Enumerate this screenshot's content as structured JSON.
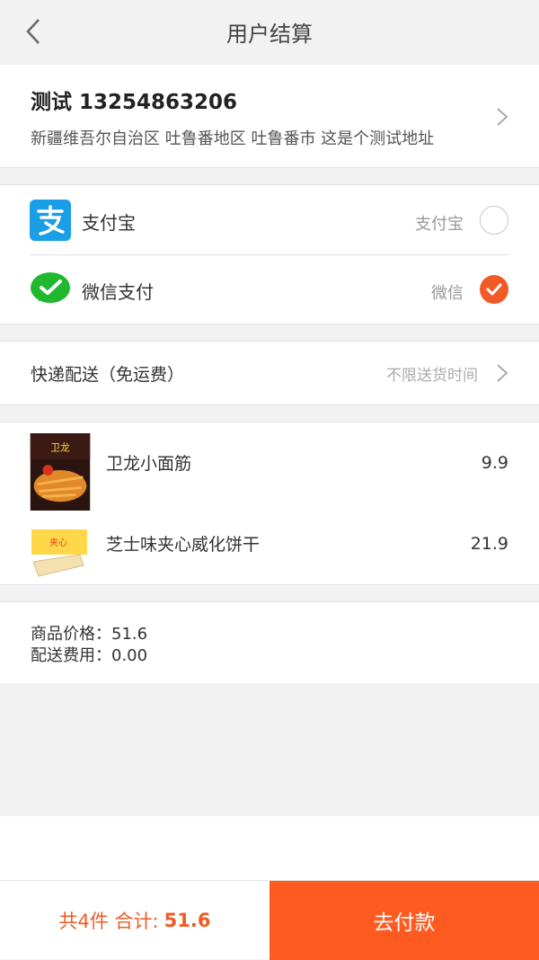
{
  "header": {
    "title": "用户结算"
  },
  "address": {
    "name": "测试 13254863206",
    "detail": "新疆维吾尔自治区 吐鲁番地区 吐鲁番市 这是个测试地址"
  },
  "payment": {
    "options": [
      {
        "label": "支付宝",
        "right_text": "支付宝",
        "selected": false,
        "icon": "alipay-icon"
      },
      {
        "label": "微信支付",
        "right_text": "微信",
        "selected": true,
        "icon": "wechat-icon"
      }
    ]
  },
  "delivery": {
    "label": "快递配送（免运费）",
    "right_text": "不限送货时间"
  },
  "goods": [
    {
      "name": "卫龙小面筋",
      "price": "9.9"
    },
    {
      "name": "芝士味夹心威化饼干",
      "price": "21.9"
    }
  ],
  "summary": {
    "goods_price": "商品价格：51.6",
    "shipping_fee": "配送费用：0.00"
  },
  "footer": {
    "count_label": "共4件 合计:",
    "total": "51.6",
    "pay_button": "去付款"
  },
  "colors": {
    "accent": "#ff5a1f",
    "alipay": "#1a9ee6",
    "wechat": "#1fb82e"
  }
}
